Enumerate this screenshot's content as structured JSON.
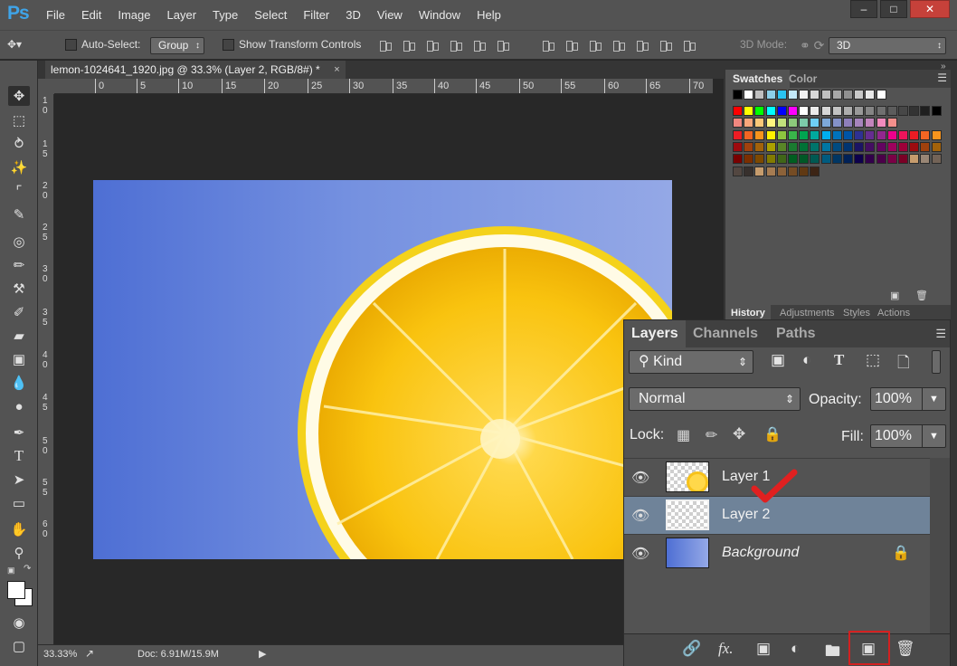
{
  "app": {
    "logo": "Ps"
  },
  "menu": [
    "File",
    "Edit",
    "Image",
    "Layer",
    "Type",
    "Select",
    "Filter",
    "3D",
    "View",
    "Window",
    "Help"
  ],
  "window_controls": {
    "minimize": "–",
    "maximize": "□",
    "close": "✕"
  },
  "options": {
    "auto_select_label": "Auto-Select:",
    "auto_select_value": "Group",
    "transform_label": "Show Transform Controls",
    "mode_label": "3D Mode:",
    "mode_value": "3D"
  },
  "document": {
    "tab_title": "lemon-1024641_1920.jpg @ 33.3% (Layer 2, RGB/8#) *",
    "close": "×"
  },
  "ruler": {
    "h_ticks": [
      "0",
      "5",
      "10",
      "15",
      "20",
      "25",
      "30",
      "35",
      "40",
      "45",
      "50",
      "55",
      "60",
      "65",
      "70"
    ],
    "v_ticks": [
      "1\n0",
      "1\n5",
      "2\n0",
      "2\n5",
      "3\n0",
      "3\n5",
      "4\n0",
      "4\n5",
      "5\n0",
      "5\n5",
      "6\n0"
    ]
  },
  "status": {
    "zoom": "33.33%",
    "doc": "Doc: 6.91M/15.9M"
  },
  "swatches": {
    "tabs": [
      "Swatches",
      "Color"
    ],
    "colors": [
      [
        "#000000",
        "#ffffff",
        "#bfbfbf",
        "#8ccfe8",
        "#29c4f1",
        "#c3e9f9",
        "#f0f0f0",
        "#d8d8d8",
        "#c0c0c0",
        "#a8a8a8",
        "#909090",
        "#c8c8c8",
        "#e8e8e8",
        "#ffffff"
      ],
      [
        "#ff0000",
        "#ffff00",
        "#00ff00",
        "#00ffff",
        "#0000ff",
        "#ff00ff",
        "#ffffff",
        "#ebebeb",
        "#d6d6d6",
        "#c2c2c2",
        "#adadad",
        "#999999",
        "#858585",
        "#707070",
        "#5c5c5c",
        "#474747",
        "#333333",
        "#1f1f1f",
        "#000000"
      ],
      [
        "#f0877f",
        "#f9a77b",
        "#fbc878",
        "#fff57f",
        "#c2e17c",
        "#8cc97b",
        "#7ccaa9",
        "#6ecff6",
        "#7da8d8",
        "#8491c7",
        "#8e7fbb",
        "#a684bc",
        "#c285bd",
        "#f08bbd",
        "#f48f8c"
      ],
      [
        "#ed1c24",
        "#f26522",
        "#f7941d",
        "#fff200",
        "#8dc63f",
        "#39b54a",
        "#00a651",
        "#00a99d",
        "#00aeef",
        "#0072bc",
        "#0054a6",
        "#2e3192",
        "#662d91",
        "#92278f",
        "#ec008c",
        "#ed145b",
        "#ed1c24",
        "#f26522",
        "#f7941d"
      ],
      [
        "#9e0b0f",
        "#a0410d",
        "#a3620a",
        "#aba000",
        "#598527",
        "#1a7b30",
        "#007236",
        "#00746b",
        "#0076a3",
        "#004b80",
        "#003471",
        "#1b1464",
        "#440e62",
        "#630460",
        "#9e005d",
        "#9e0039",
        "#9e0b0f",
        "#a0410d",
        "#a3620a"
      ],
      [
        "#790000",
        "#7b2e00",
        "#7d4900",
        "#827b00",
        "#406618",
        "#005e20",
        "#005826",
        "#005952",
        "#005b7f",
        "#003663",
        "#002157",
        "#0d004c",
        "#32004b",
        "#4b0049",
        "#7b0046",
        "#7a0026",
        "#c69c6d",
        "#998675",
        "#736357"
      ],
      [
        "#534741",
        "#37302d",
        "#c69c6d",
        "#a67c52",
        "#8c6239",
        "#754c24",
        "#603913",
        "#3c2415"
      ]
    ]
  },
  "mini_tabs": [
    "History",
    "Adjustments",
    "Styles",
    "Actions"
  ],
  "layers_panel": {
    "tabs": [
      "Layers",
      "Channels",
      "Paths"
    ],
    "filter": "Kind",
    "blend_mode": "Normal",
    "opacity_label": "Opacity:",
    "opacity_value": "100%",
    "lock_label": "Lock:",
    "fill_label": "Fill:",
    "fill_value": "100%",
    "layers": [
      {
        "name": "Layer 1",
        "selected": false
      },
      {
        "name": "Layer 2",
        "selected": true
      },
      {
        "name": "Background",
        "selected": false,
        "locked": true
      }
    ]
  },
  "colors": {
    "accent_select": "#6f8399",
    "highlight": "#d42020",
    "canvas_left": "#4e6fd4",
    "canvas_right": "#94a8e6",
    "lemon": "#f9c30f"
  }
}
